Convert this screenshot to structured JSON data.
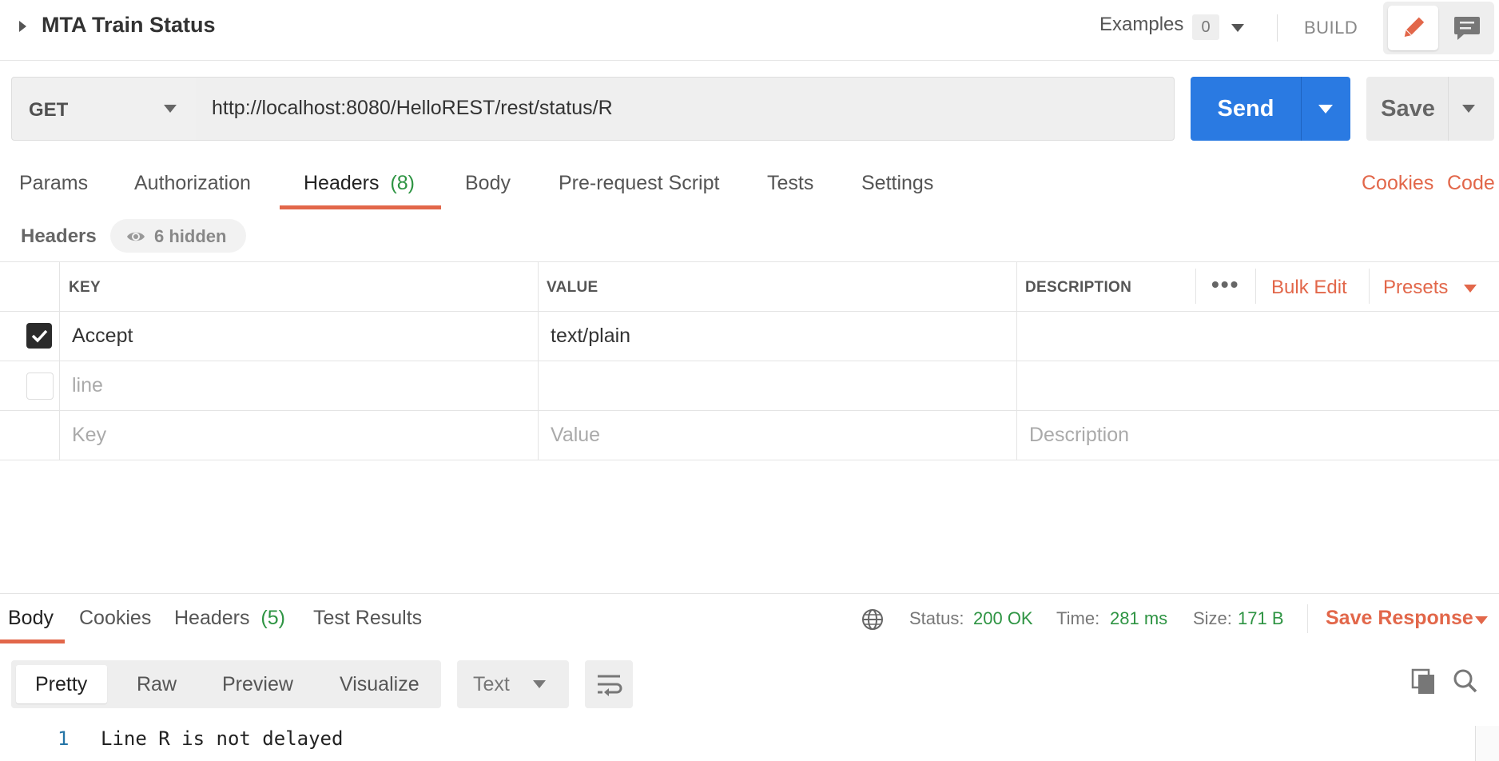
{
  "request": {
    "title": "MTA Train Status",
    "examples_label": "Examples",
    "examples_count": "0",
    "build_label": "BUILD",
    "method": "GET",
    "url": "http://localhost:8080/HelloREST/rest/status/R",
    "send_label": "Send",
    "save_label": "Save"
  },
  "request_tabs": {
    "params": "Params",
    "authorization": "Authorization",
    "headers": "Headers",
    "headers_count": "(8)",
    "body": "Body",
    "prerequest": "Pre-request Script",
    "tests": "Tests",
    "settings": "Settings",
    "cookies": "Cookies",
    "code": "Code"
  },
  "headers_section": {
    "title": "Headers",
    "hidden": "6 hidden",
    "columns": {
      "key": "KEY",
      "value": "VALUE",
      "description": "DESCRIPTION"
    },
    "bulk_edit": "Bulk Edit",
    "presets": "Presets",
    "rows": [
      {
        "checked": true,
        "key": "Accept",
        "value": "text/plain",
        "description": ""
      },
      {
        "checked": false,
        "key": "line",
        "value": "",
        "description": ""
      }
    ],
    "placeholders": {
      "key": "Key",
      "value": "Value",
      "description": "Description"
    }
  },
  "response": {
    "tabs": {
      "body": "Body",
      "cookies": "Cookies",
      "headers": "Headers",
      "headers_count": "(5)",
      "tests": "Test Results"
    },
    "status_label": "Status:",
    "status_value": "200 OK",
    "time_label": "Time:",
    "time_value": "281 ms",
    "size_label": "Size:",
    "size_value": "171 B",
    "save_response": "Save Response",
    "formats": {
      "pretty": "Pretty",
      "raw": "Raw",
      "preview": "Preview",
      "visualize": "Visualize"
    },
    "language": "Text",
    "lines": [
      {
        "number": "1",
        "text": "Line R is not delayed"
      }
    ]
  },
  "colors": {
    "accent": "#e2674a",
    "primary": "#2a7ae2",
    "success": "#2e9443"
  }
}
